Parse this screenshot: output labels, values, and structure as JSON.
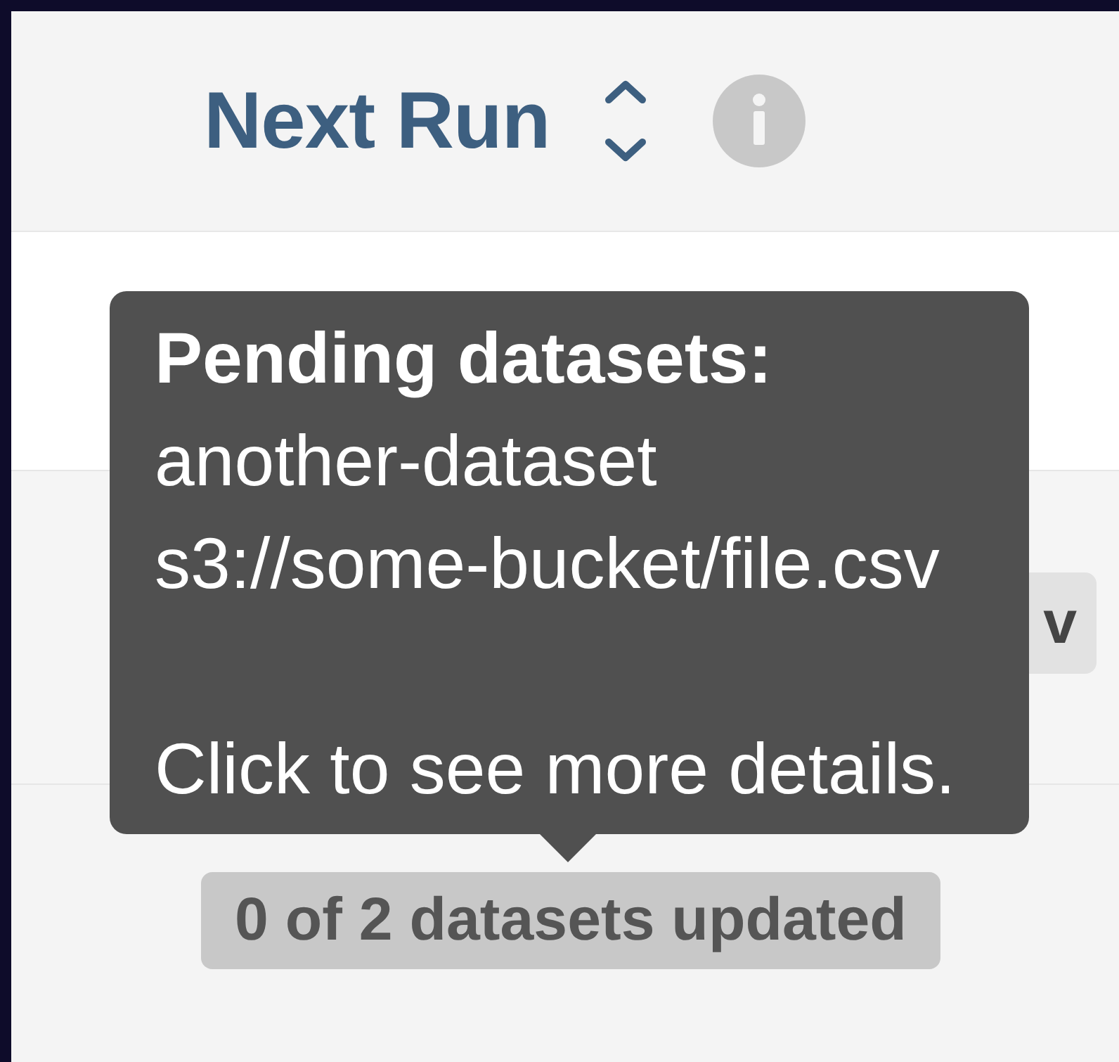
{
  "column_header": {
    "label": "Next Run"
  },
  "rows": [
    {
      "kind": "empty"
    },
    {
      "kind": "badge",
      "badge": "v"
    },
    {
      "kind": "status",
      "badge": "0 of 2 datasets updated"
    }
  ],
  "tooltip": {
    "title": "Pending datasets:",
    "lines": [
      "another-dataset",
      "s3://some-bucket/file.csv"
    ],
    "footer": "Click to see more details."
  }
}
